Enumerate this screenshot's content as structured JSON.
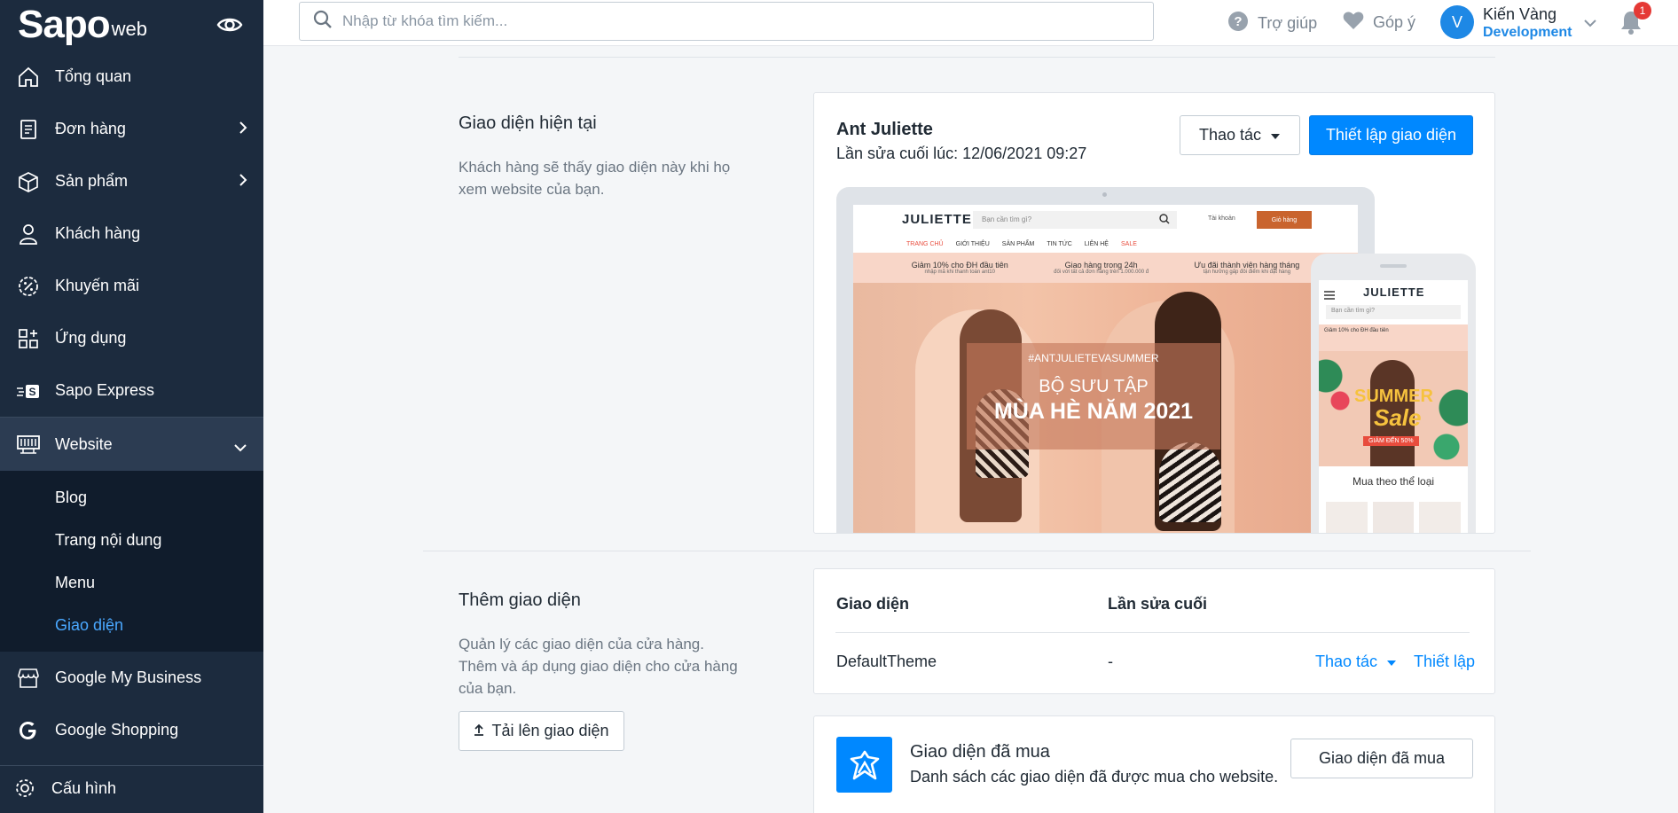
{
  "brand": {
    "logo": "Sapo",
    "logo_sub": "web"
  },
  "sidebar": {
    "items": [
      {
        "label": "Tổng quan"
      },
      {
        "label": "Đơn hàng"
      },
      {
        "label": "Sản phẩm"
      },
      {
        "label": "Khách hàng"
      },
      {
        "label": "Khuyến mãi"
      },
      {
        "label": "Ứng dụng"
      },
      {
        "label": "Sapo Express"
      },
      {
        "label": "Website"
      }
    ],
    "website_sub": [
      "Blog",
      "Trang nội dung",
      "Menu",
      "Giao diện"
    ],
    "extra": [
      {
        "label": "Google My Business"
      },
      {
        "label": "Google Shopping"
      }
    ],
    "config_label": "Cấu hình"
  },
  "topbar": {
    "search_placeholder": "Nhập từ khóa tìm kiếm...",
    "help_label": "Trợ giúp",
    "feedback_label": "Góp ý",
    "avatar_initial": "V",
    "user_name": "Kiến Vàng",
    "user_role": "Development",
    "notification_count": "1"
  },
  "current_theme": {
    "section_title": "Giao diện hiện tại",
    "section_desc_1": "Khách hàng sẽ thấy giao diện này khi họ",
    "section_desc_2": "xem website của bạn.",
    "name": "Ant Juliette",
    "last_edited": "Lần sửa cuối lúc: 12/06/2021 09:27",
    "action_button": "Thao tác",
    "setup_button": "Thiết lập giao diện"
  },
  "preview": {
    "logo": "JULIETTE",
    "search": "Bạn cần tìm gì?",
    "account": "Tài khoản",
    "cart": "Giỏ hàng",
    "nav": [
      "TRANG CHỦ",
      "GIỚI THIỆU",
      "SẢN PHẨM",
      "TIN TỨC",
      "LIÊN HỆ",
      "SALE"
    ],
    "promos": [
      {
        "title": "Giảm 10% cho ĐH đầu tiên",
        "sub": "nhập mã khi thanh toán ant10"
      },
      {
        "title": "Giao hàng trong 24h",
        "sub": "đối với tất cả đơn hàng trên 1.000.000 đ"
      },
      {
        "title": "Ưu đãi thành viên hàng tháng",
        "sub": "tận hưởng gấp đôi điểm khi đặt hàng"
      }
    ],
    "banner_tag": "#ANTJULIETEVASUMMER",
    "banner_sub": "BỘ SƯU TẬP",
    "banner_main": "MÙA HÈ NĂM 2021",
    "mobile_logo": "JULIETTE",
    "mobile_search": "Bạn cần tìm gì?",
    "mobile_promo": "Giảm 10% cho ĐH đầu tiên",
    "mobile_category": "Mua theo thể loại",
    "mobile_summer": "SUMMER",
    "mobile_sale": "Sale",
    "mobile_sale_badge": "GIẢM ĐẾN 50%"
  },
  "add_theme": {
    "section_title": "Thêm giao diện",
    "desc_1": "Quản lý các giao diện của cửa hàng.",
    "desc_2": "Thêm và áp dụng giao diện cho cửa hàng",
    "desc_3": "của bạn.",
    "upload_button": "Tải lên giao diện",
    "table": {
      "col_theme": "Giao diện",
      "col_edited": "Lần sửa cuối",
      "rows": [
        {
          "name": "DefaultTheme",
          "edited": "-",
          "action": "Thao tác",
          "setup": "Thiết lập"
        }
      ]
    }
  },
  "bought": {
    "title": "Giao diện đã mua",
    "desc": "Danh sách các giao diện đã được mua cho website.",
    "button": "Giao diện đã mua"
  },
  "colors": {
    "sidebar_bg": "#1c2b3e",
    "primary": "#0088ff",
    "active_link": "#4aa8ff"
  }
}
